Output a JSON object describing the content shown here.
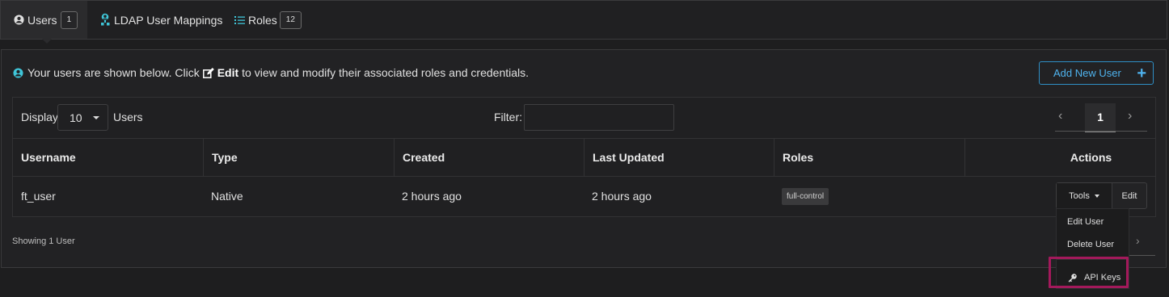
{
  "tabs": [
    {
      "label": "Users",
      "count": "1",
      "icon": "user-circle-icon"
    },
    {
      "label": "LDAP User Mappings",
      "icon": "ldap-users-icon"
    },
    {
      "label": "Roles",
      "count": "12",
      "icon": "list-icon"
    }
  ],
  "info": {
    "prefix": "Your users are shown below. Click",
    "edit_word": "Edit",
    "suffix": "to view and modify their associated roles and credentials."
  },
  "add_button": {
    "label": "Add New User",
    "icon": "plus-icon"
  },
  "controls": {
    "display_label": "Display",
    "page_size": "10",
    "users_label": "Users",
    "filter_label": "Filter:",
    "filter_value": ""
  },
  "pagination": {
    "prev": "‹",
    "current": "1",
    "next": "›"
  },
  "table": {
    "columns": [
      "Username",
      "Type",
      "Created",
      "Last Updated",
      "Roles",
      "Actions"
    ],
    "rows": [
      {
        "username": "ft_user",
        "type": "Native",
        "created": "2 hours ago",
        "updated": "2 hours ago",
        "role": "full-control"
      }
    ]
  },
  "row_actions": {
    "tools_label": "Tools",
    "edit_label": "Edit"
  },
  "footer": {
    "showing": "Showing 1 User",
    "next": "›"
  },
  "dropdown": {
    "items": [
      "Edit User",
      "Delete User"
    ],
    "api_keys": "API Keys",
    "api_icon": "key-icon"
  },
  "colors": {
    "accent": "#4fb3ee",
    "highlight": "#a3195b",
    "background": "#1e1e1f"
  }
}
